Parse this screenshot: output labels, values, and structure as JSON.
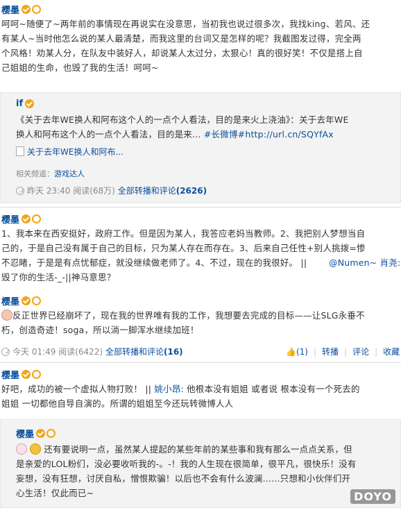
{
  "post1": {
    "author": "樱墨",
    "lines": [
      "呵呵~随便了~两年前的事情现在再说实在没意思，当初我也说过很多次，我找king、若风、还",
      "有某人~当时他怎么说的某人最清楚，而我这里的台词又是怎样的呢？我截图发过得，完全两",
      "个风格！劝某人分，在队友中装好人，却说某人太过分，太狠心！真的很好笑！不仅是搭上自",
      "己姐姐的生命，也毁了我的生活！呵呵~"
    ]
  },
  "repost1": {
    "author": "if",
    "line1": "《关于去年WE换人和阿布这个人的一点个人看法，目的是来火上浇油》：关于去年WE",
    "line2_text": "换人和阿布这个人的一点个人看法，目的是来… ",
    "line2_tag": "#长微博#",
    "line2_link": "http://url.cn/SQYfAx",
    "attachment": "关于去年WE换人和阿布...",
    "channel_label": "相关频道：",
    "channel": "游戏达人",
    "time": "昨天 23:40",
    "reads": "阅读(68万)",
    "all_label": "全部转播和评论",
    "all_count": "(2626)"
  },
  "post2": {
    "author": "樱墨",
    "lines": [
      "1、我本来在西安挺好，政府工作。但是因为某人，我答应老妈当教师。2、我把别人梦想当自",
      "己的，于是自己没有属于自己的目标，只为某人存在而存在。3、后来自己任性+别人挑拨=惨",
      "不忍睹，于是是有点忧郁症，就没继续做老师了。4、不过，现在的我很好。 || ",
      "毁了你的生活-_-||神马意思？"
    ],
    "mention": "@Numen~ 肖尧:"
  },
  "post3": {
    "author": "樱墨",
    "line1": "反正世界已经崩坏了，现在我的世界唯有我的工作，我想要去完成的目标——让SLG永垂不",
    "line2": "朽，创造奇迹！soga，所以淌一脚浑水继续加班！",
    "time": "今天 01:49",
    "reads": "阅读(6422)",
    "all_label": "全部转播和评论",
    "all_count": "(16)",
    "like": "(1)",
    "repost": "转播",
    "comment": "评论",
    "favorite": "收藏"
  },
  "post4": {
    "author": "樱墨",
    "line1_text": "好吧，成功的被一个虚拟人物打败！ || ",
    "line1_mention": "姚小昂:",
    "line1_rest": " 他根本没有姐姐 或者说 根本没有一个死去的",
    "line2": "姐姐 一切都他自导自演的。所谓的姐姐至今还玩转微博人人"
  },
  "repost2": {
    "author": "樱墨",
    "lines": [
      "还有要说明一点，虽然某人提起的某些年前的某些事和我有那么一点点关系，但",
      "是亲爱的LOL粉们，没必要收听我的-。-！我的人生现在很简单，很平凡，很快乐！没有",
      "妄想，没有狂想，讨厌自私，憎恨欺骗！以后也不会有什么波澜......只想和小伙伴们开",
      "心生活！仅此而已~"
    ]
  },
  "watermark": "DOYO",
  "colors": {
    "link": "#0a4f9e",
    "badge": "#f2a516",
    "repost_bg": "#f3f3f3"
  }
}
